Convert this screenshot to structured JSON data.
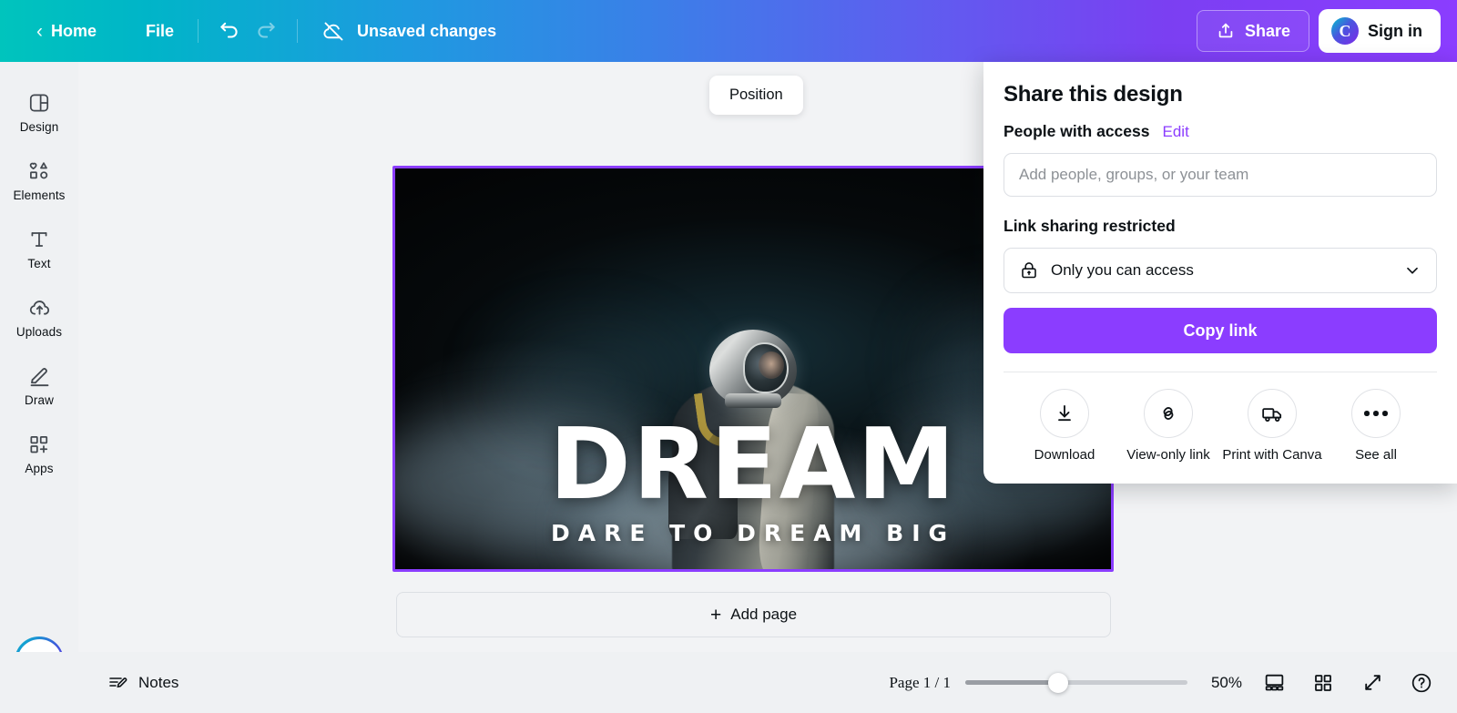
{
  "topbar": {
    "back_icon": "chevron-left-icon",
    "home_label": "Home",
    "file_label": "File",
    "undo_icon": "undo-icon",
    "redo_icon": "redo-icon",
    "cloud_icon": "cloud-offline-icon",
    "status_label": "Unsaved changes",
    "share_label": "Share",
    "share_icon": "upload-share-icon",
    "signin_label": "Sign in",
    "brand_mark": "C",
    "gradient_from": "#00c4bd",
    "gradient_to": "#8b3dff"
  },
  "sidebar": {
    "items": [
      {
        "label": "Design",
        "icon": "design-layout-icon"
      },
      {
        "label": "Elements",
        "icon": "shapes-elements-icon"
      },
      {
        "label": "Text",
        "icon": "text-t-icon"
      },
      {
        "label": "Uploads",
        "icon": "cloud-upload-icon"
      },
      {
        "label": "Draw",
        "icon": "pen-draw-icon"
      },
      {
        "label": "Apps",
        "icon": "apps-grid-plus-icon"
      }
    ],
    "ai_button_icon": "magic-sparkle-icon"
  },
  "canvas": {
    "position_button": "Position",
    "add_page_label": "Add page",
    "add_page_icon": "plus-icon",
    "selection_color": "#8b3dff",
    "design": {
      "headline": "DREAM",
      "subline": "DARE TO DREAM BIG",
      "background_description": "astronaut-in-smoke-photo"
    }
  },
  "share_panel": {
    "title": "Share this design",
    "people_label": "People with access",
    "edit_label": "Edit",
    "people_input_placeholder": "Add people, groups, or your team",
    "people_input_value": "",
    "link_sharing_label": "Link sharing restricted",
    "access_select_value": "Only you can access",
    "access_select_icon": "lock-icon",
    "chevron_icon": "chevron-down-icon",
    "copy_link_label": "Copy link",
    "copy_link_color": "#8b3dff",
    "actions": [
      {
        "label": "Download",
        "icon": "download-arrow-icon"
      },
      {
        "label": "View-only link",
        "icon": "link-chain-icon"
      },
      {
        "label": "Print with Canva",
        "icon": "delivery-truck-icon"
      },
      {
        "label": "See all",
        "icon": "more-dots-icon"
      }
    ]
  },
  "bottombar": {
    "notes_label": "Notes",
    "notes_icon": "notes-pencil-icon",
    "page_indicator": "Page 1 / 1",
    "zoom_level": "50%",
    "zoom_slider_percent": 42,
    "view_icons": [
      {
        "icon": "presentation-view-icon"
      },
      {
        "icon": "grid-view-icon"
      },
      {
        "icon": "fullscreen-expand-icon"
      },
      {
        "icon": "help-question-icon"
      }
    ]
  }
}
